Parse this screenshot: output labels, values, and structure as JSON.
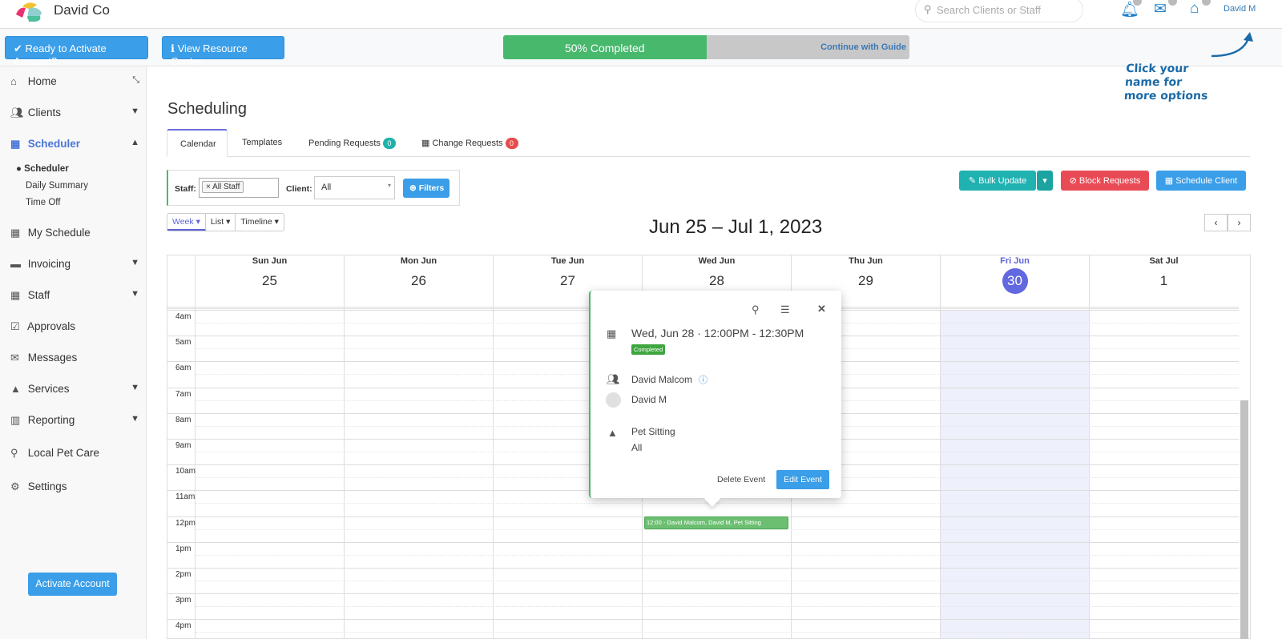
{
  "header": {
    "brand": "David Co",
    "search_placeholder": "Search Clients or Staff",
    "user": "David M"
  },
  "bar": {
    "activate_label": "Ready to Activate Account?",
    "resource_label": "View Resource Center",
    "progress_label": "50% Completed",
    "progress": 50,
    "continue_label": "Continue with Guide",
    "hint": "Click your name for more options"
  },
  "sidebar": {
    "items": [
      {
        "label": "Home",
        "icon": "home-icon"
      },
      {
        "label": "Clients",
        "icon": "users-icon"
      },
      {
        "label": "Scheduler",
        "icon": "calendar-icon"
      },
      {
        "label": "My Schedule",
        "icon": "calendar-icon"
      },
      {
        "label": "Invoicing",
        "icon": "credit-card-icon"
      },
      {
        "label": "Staff",
        "icon": "grid-icon"
      },
      {
        "label": "Approvals",
        "icon": "check-square-icon"
      },
      {
        "label": "Messages",
        "icon": "envelope-icon"
      },
      {
        "label": "Services",
        "icon": "road-icon"
      },
      {
        "label": "Reporting",
        "icon": "bar-chart-icon"
      },
      {
        "label": "Local Pet Care",
        "icon": "pet-care-icon"
      },
      {
        "label": "Settings",
        "icon": "gears-icon"
      }
    ],
    "sub": [
      "Scheduler",
      "Daily Summary",
      "Time Off"
    ],
    "activate_button": "Activate Account"
  },
  "main": {
    "title": "Scheduling",
    "tabs": [
      {
        "label": "Calendar"
      },
      {
        "label": "Templates"
      },
      {
        "label": "Pending Requests",
        "count": "0",
        "color": "#20b2aa"
      },
      {
        "label": "Change Requests",
        "count": "0",
        "color": "#e84b4b"
      }
    ],
    "filters": {
      "staff_label": "Staff:",
      "staff_chip": "All Staff",
      "client_label": "Client:",
      "client_value": "All",
      "filters_button": "Filters"
    },
    "actions": {
      "bulk": "Bulk Update",
      "block": "Block Requests",
      "schedule": "Schedule Client"
    },
    "views": [
      "Week",
      "List",
      "Timeline"
    ],
    "range": "Jun 25 – Jul 1, 2023",
    "days": [
      {
        "name": "Sun Jun",
        "num": "25"
      },
      {
        "name": "Mon Jun",
        "num": "26"
      },
      {
        "name": "Tue Jun",
        "num": "27"
      },
      {
        "name": "Wed Jun",
        "num": "28"
      },
      {
        "name": "Thu Jun",
        "num": "29"
      },
      {
        "name": "Fri Jun",
        "num": "30",
        "today": true
      },
      {
        "name": "Sat Jul",
        "num": "1"
      }
    ],
    "hours": [
      "4am",
      "5am",
      "6am",
      "7am",
      "8am",
      "9am",
      "10am",
      "11am",
      "12pm",
      "1pm",
      "2pm",
      "3pm",
      "4pm"
    ],
    "event": "12:00 - David Malcom, David M, Pet Sitting"
  },
  "popover": {
    "datetime": "Wed, Jun 28 · 12:00PM - 12:30PM",
    "status": "Completed",
    "client": "David Malcom",
    "staff": "David M",
    "service": "Pet Sitting",
    "service_detail": "All",
    "delete": "Delete Event",
    "edit": "Edit Event"
  }
}
